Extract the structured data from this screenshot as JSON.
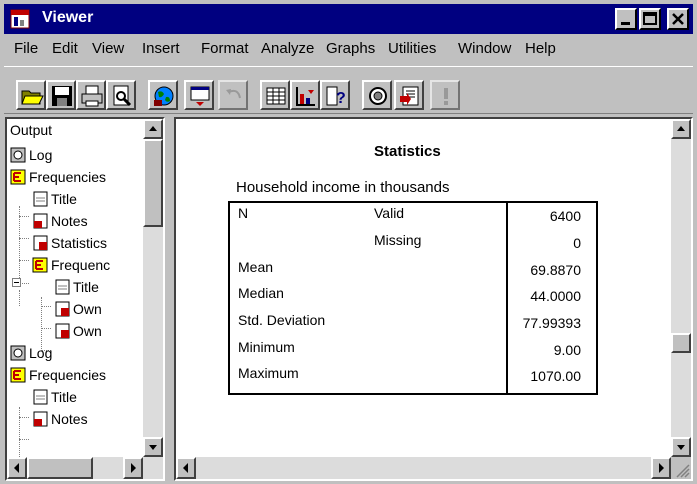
{
  "window": {
    "title": "Viewer"
  },
  "menu": [
    "File",
    "Edit",
    "View",
    "Insert",
    "Format",
    "Analyze",
    "Graphs",
    "Utilities",
    "Window",
    "Help"
  ],
  "toolbar": [
    {
      "icon": "open-folder-icon"
    },
    {
      "icon": "save-disk-icon"
    },
    {
      "icon": "print-icon"
    },
    {
      "icon": "print-preview-icon"
    },
    {
      "icon": "export-globe-icon"
    },
    {
      "icon": "recall-dialog-icon"
    },
    {
      "icon": "undo-icon"
    },
    {
      "icon": "goto-data-icon"
    },
    {
      "icon": "goto-chart-icon"
    },
    {
      "icon": "variables-info-icon"
    },
    {
      "icon": "use-sets-icon"
    },
    {
      "icon": "designate-window-icon"
    },
    {
      "icon": "run-icon"
    }
  ],
  "outline": {
    "items": [
      {
        "label": "Output",
        "icon": "",
        "level": 0
      },
      {
        "label": "Log",
        "icon": "log-book-icon",
        "level": 0
      },
      {
        "label": "Frequencies",
        "icon": "frequencies-icon",
        "level": 0
      },
      {
        "label": "Title",
        "icon": "title-page-icon",
        "level": 1
      },
      {
        "label": "Notes",
        "icon": "notes-icon",
        "level": 1
      },
      {
        "label": "Statistics",
        "icon": "table-icon",
        "level": 1
      },
      {
        "label": "Frequenc",
        "icon": "frequencies-icon",
        "level": 1
      },
      {
        "label": "Title",
        "icon": "title-page-icon",
        "level": 2
      },
      {
        "label": "Own",
        "icon": "table-icon",
        "level": 2
      },
      {
        "label": "Own",
        "icon": "table-icon",
        "level": 2
      },
      {
        "label": "Log",
        "icon": "log-book-icon",
        "level": 0
      },
      {
        "label": "Frequencies",
        "icon": "frequencies-icon",
        "level": 0
      },
      {
        "label": "Title",
        "icon": "title-page-icon",
        "level": 1
      },
      {
        "label": "Notes",
        "icon": "notes-icon",
        "level": 1
      }
    ]
  },
  "statistics": {
    "title": "Statistics",
    "caption": "Household income in thousands",
    "rows": [
      {
        "label": "N",
        "sub": "Valid",
        "value": "6400"
      },
      {
        "label": "",
        "sub": "Missing",
        "value": "0"
      },
      {
        "label": "Mean",
        "sub": "",
        "value": "69.8870"
      },
      {
        "label": "Median",
        "sub": "",
        "value": "44.0000"
      },
      {
        "label": "Std. Deviation",
        "sub": "",
        "value": "77.99393"
      },
      {
        "label": "Minimum",
        "sub": "",
        "value": "9.00"
      },
      {
        "label": "Maximum",
        "sub": "",
        "value": "1070.00"
      }
    ]
  },
  "colors": {
    "titlebar": "#000080",
    "chrome": "#c0c0c0"
  }
}
